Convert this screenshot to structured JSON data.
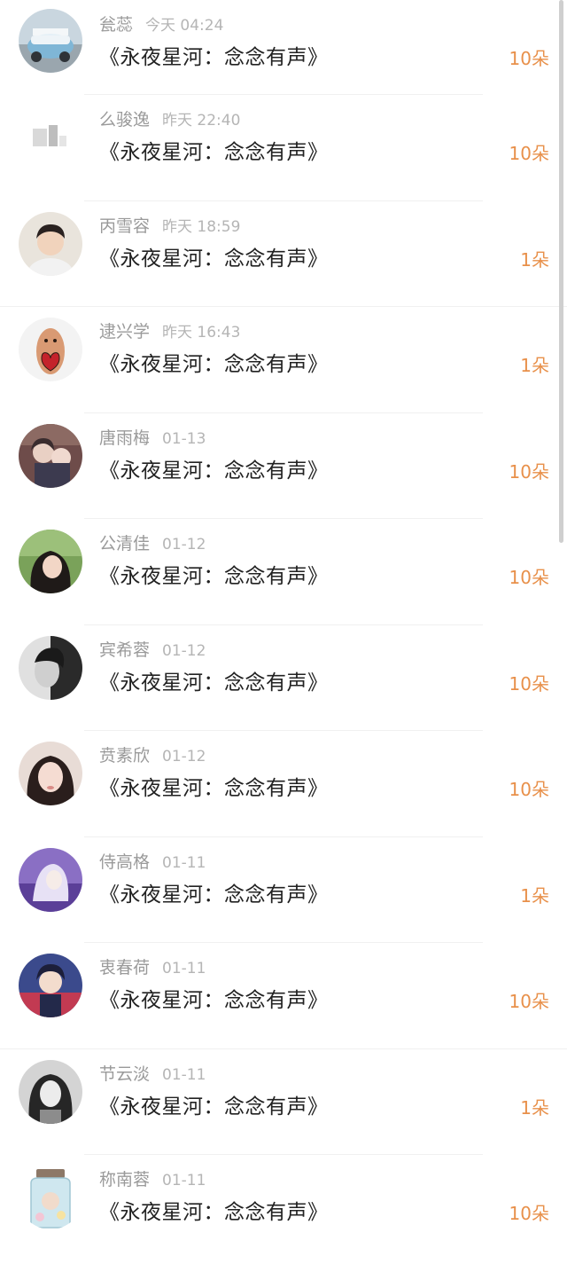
{
  "accent_color": "#e8904a",
  "records": [
    {
      "name": "瓮蕊",
      "time": "今天 04:24",
      "title": "《永夜星河：念念有声》",
      "amount": "10朵",
      "avatar": "car-photo-avatar"
    },
    {
      "name": "么骏逸",
      "time": "昨天 22:40",
      "title": "《永夜星河：念念有声》",
      "amount": "10朵",
      "avatar": "faded-sketch-avatar"
    },
    {
      "name": "丙雪容",
      "time": "昨天 18:59",
      "title": "《永夜星河：念念有声》",
      "amount": "1朵",
      "avatar": "boy-portrait-avatar"
    },
    {
      "name": "逮兴学",
      "time": "昨天 16:43",
      "title": "《永夜星河：念念有声》",
      "amount": "1朵",
      "avatar": "heart-doll-avatar"
    },
    {
      "name": "唐雨梅",
      "time": "01-13",
      "title": "《永夜星河：念念有声》",
      "amount": "10朵",
      "avatar": "anime-couple-avatar"
    },
    {
      "name": "公清佳",
      "time": "01-12",
      "title": "《永夜星河：念念有声》",
      "amount": "10朵",
      "avatar": "girl-greenery-avatar"
    },
    {
      "name": "宾希蓉",
      "time": "01-12",
      "title": "《永夜星河：念念有声》",
      "amount": "10朵",
      "avatar": "monochrome-portrait-avatar"
    },
    {
      "name": "贲素欣",
      "time": "01-12",
      "title": "《永夜星河：念念有声》",
      "amount": "10朵",
      "avatar": "girl-selfie-avatar"
    },
    {
      "name": "侍高格",
      "time": "01-11",
      "title": "《永夜星河：念念有声》",
      "amount": "1朵",
      "avatar": "anime-purple-avatar"
    },
    {
      "name": "衷春荷",
      "time": "01-11",
      "title": "《永夜星河：念念有声》",
      "amount": "10朵",
      "avatar": "anime-boy-avatar"
    },
    {
      "name": "节云淡",
      "time": "01-11",
      "title": "《永夜星河：念念有声》",
      "amount": "1朵",
      "avatar": "bw-girl-avatar"
    },
    {
      "name": "称南蓉",
      "time": "01-11",
      "title": "《永夜星河：念念有声》",
      "amount": "10朵",
      "avatar": "jar-illustration-avatar"
    }
  ]
}
